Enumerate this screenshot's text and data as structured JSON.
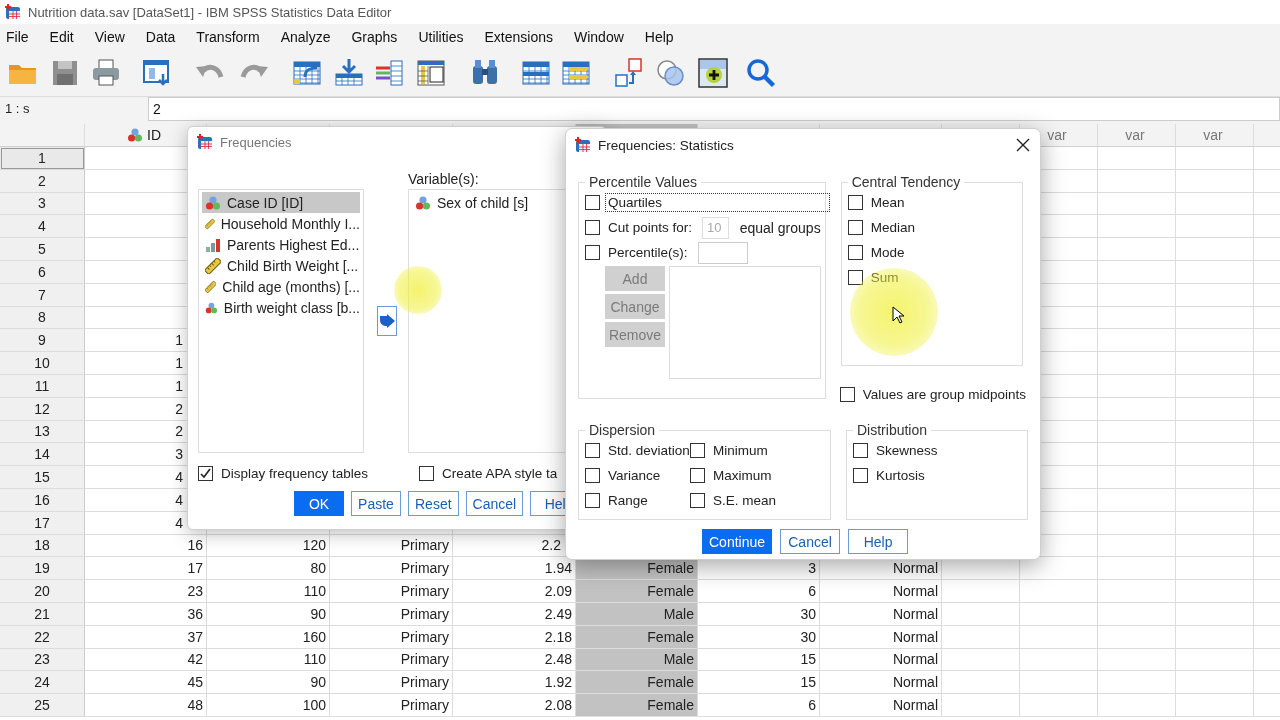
{
  "window": {
    "title": "Nutrition data.sav [DataSet1] - IBM SPSS Statistics Data Editor"
  },
  "menu": [
    "File",
    "Edit",
    "View",
    "Data",
    "Transform",
    "Analyze",
    "Graphs",
    "Utilities",
    "Extensions",
    "Window",
    "Help"
  ],
  "cell_editor": {
    "reference": "1 : s",
    "value": "2"
  },
  "grid": {
    "columns": [
      {
        "kind": "nominal",
        "header": "ID",
        "selected": false
      },
      {
        "kind": "variable",
        "selected": false
      },
      {
        "kind": "variable",
        "selected": false
      },
      {
        "kind": "variable",
        "selected": false
      },
      {
        "kind": "variable",
        "selected": true
      },
      {
        "kind": "variable",
        "selected": false
      },
      {
        "kind": "variable",
        "selected": false
      },
      {
        "kind": "variable",
        "selected": false
      },
      {
        "kind": "empty",
        "header": "var",
        "selected": false
      },
      {
        "kind": "empty",
        "header": "var",
        "selected": false
      },
      {
        "kind": "empty",
        "header": "var",
        "selected": false
      },
      {
        "kind": "empty",
        "selected": false
      }
    ],
    "rows": [
      {
        "number": "1",
        "selected": true
      },
      {
        "number": "2",
        "selected": false
      },
      {
        "number": "3",
        "selected": false
      },
      {
        "number": "4",
        "selected": false
      },
      {
        "number": "5",
        "selected": false
      },
      {
        "number": "6",
        "selected": false
      },
      {
        "number": "7",
        "selected": false
      },
      {
        "number": "8",
        "selected": false
      },
      {
        "number": "9",
        "selected": false,
        "cells": [
          "1"
        ]
      },
      {
        "number": "10",
        "selected": false,
        "cells": [
          "1"
        ]
      },
      {
        "number": "11",
        "selected": false,
        "cells": [
          "1"
        ]
      },
      {
        "number": "12",
        "selected": false,
        "cells": [
          "2"
        ]
      },
      {
        "number": "13",
        "selected": false,
        "cells": [
          "2"
        ]
      },
      {
        "number": "14",
        "selected": false,
        "cells": [
          "3"
        ]
      },
      {
        "number": "15",
        "selected": false,
        "cells": [
          "4"
        ]
      },
      {
        "number": "16",
        "selected": false,
        "cells": [
          "4"
        ]
      },
      {
        "number": "17",
        "selected": false,
        "cells": [
          "4"
        ]
      },
      {
        "number": "18",
        "selected": false,
        "cells": [
          "16",
          "120",
          "Primary",
          "2.2"
        ]
      },
      {
        "number": "19",
        "selected": false,
        "cells": [
          "17",
          "80",
          "Primary",
          "1.94",
          "Female",
          "3",
          "Normal"
        ]
      },
      {
        "number": "20",
        "selected": false,
        "cells": [
          "23",
          "110",
          "Primary",
          "2.09",
          "Female",
          "6",
          "Normal"
        ]
      },
      {
        "number": "21",
        "selected": false,
        "cells": [
          "36",
          "90",
          "Primary",
          "2.49",
          "Male",
          "30",
          "Normal"
        ]
      },
      {
        "number": "22",
        "selected": false,
        "cells": [
          "37",
          "160",
          "Primary",
          "2.18",
          "Female",
          "30",
          "Normal"
        ]
      },
      {
        "number": "23",
        "selected": false,
        "cells": [
          "42",
          "110",
          "Primary",
          "2.48",
          "Male",
          "15",
          "Normal"
        ]
      },
      {
        "number": "24",
        "selected": false,
        "cells": [
          "45",
          "90",
          "Primary",
          "1.92",
          "Female",
          "15",
          "Normal"
        ]
      },
      {
        "number": "25",
        "selected": false,
        "cells": [
          "48",
          "100",
          "Primary",
          "2.08",
          "Female",
          "6",
          "Normal"
        ]
      }
    ]
  },
  "frequencies_dialog": {
    "title": "Frequencies",
    "source_list": [
      {
        "label": "Case ID [ID]",
        "kind": "nominal",
        "selected": true
      },
      {
        "label": "Household Monthly I...",
        "kind": "scale",
        "selected": false
      },
      {
        "label": "Parents Highest Ed...",
        "kind": "ordinal",
        "selected": false
      },
      {
        "label": "Child Birth Weight [...",
        "kind": "scale",
        "selected": false
      },
      {
        "label": "Child age (months) [...",
        "kind": "scale",
        "selected": false
      },
      {
        "label": "Birth weight class [b...",
        "kind": "nominal",
        "selected": false
      }
    ],
    "target_label": "Variable(s):",
    "target_list": [
      {
        "label": "Sex of child [s]",
        "kind": "nominal",
        "selected": false
      }
    ],
    "checkboxes": [
      {
        "label": "Display frequency tables",
        "checked": true
      },
      {
        "label": "Create APA style ta",
        "checked": false
      }
    ],
    "buttons": [
      {
        "label": "OK",
        "default": true
      },
      {
        "label": "Paste",
        "default": false
      },
      {
        "label": "Reset",
        "default": false
      },
      {
        "label": "Cancel",
        "default": false
      },
      {
        "label": "Hel",
        "default": false
      }
    ]
  },
  "statistics_dialog": {
    "title": "Frequencies: Statistics",
    "percentile_values": {
      "label": "Percentile Values",
      "options": [
        {
          "kind": "plain",
          "label": "Quartiles",
          "checked": false,
          "focused": true
        },
        {
          "kind": "field",
          "label": "Cut points for:",
          "checked": false,
          "focused": false,
          "field": {
            "value": "10",
            "disabled": true
          },
          "suffix": "equal groups"
        },
        {
          "kind": "field",
          "label": "Percentile(s):",
          "checked": false,
          "focused": false,
          "field": {
            "disabled": false
          }
        }
      ],
      "buttons": [
        {
          "label": "Add",
          "disabled": true
        },
        {
          "label": "Change",
          "disabled": true
        },
        {
          "label": "Remove",
          "disabled": true
        }
      ]
    },
    "central_tendency": {
      "label": "Central Tendency",
      "options": [
        {
          "label": "Mean",
          "checked": false
        },
        {
          "label": "Median",
          "checked": false
        },
        {
          "label": "Mode",
          "checked": false
        },
        {
          "label": "Sum",
          "checked": false
        }
      ]
    },
    "group_midpoints": {
      "label": "Values are group midpoints",
      "checked": false
    },
    "dispersion": {
      "label": "Dispersion",
      "options": [
        {
          "label": "Std. deviation",
          "checked": false
        },
        {
          "label": "Minimum",
          "checked": false
        },
        {
          "label": "Variance",
          "checked": false
        },
        {
          "label": "Maximum",
          "checked": false
        },
        {
          "label": "Range",
          "checked": false
        },
        {
          "label": "S.E. mean",
          "checked": false
        }
      ]
    },
    "distribution": {
      "label": "Distribution",
      "options": [
        {
          "label": "Skewness",
          "checked": false
        },
        {
          "label": "Kurtosis",
          "checked": false
        }
      ]
    },
    "buttons": [
      {
        "label": "Continue",
        "default": true
      },
      {
        "label": "Cancel",
        "default": false
      },
      {
        "label": "Help",
        "default": false
      }
    ]
  }
}
